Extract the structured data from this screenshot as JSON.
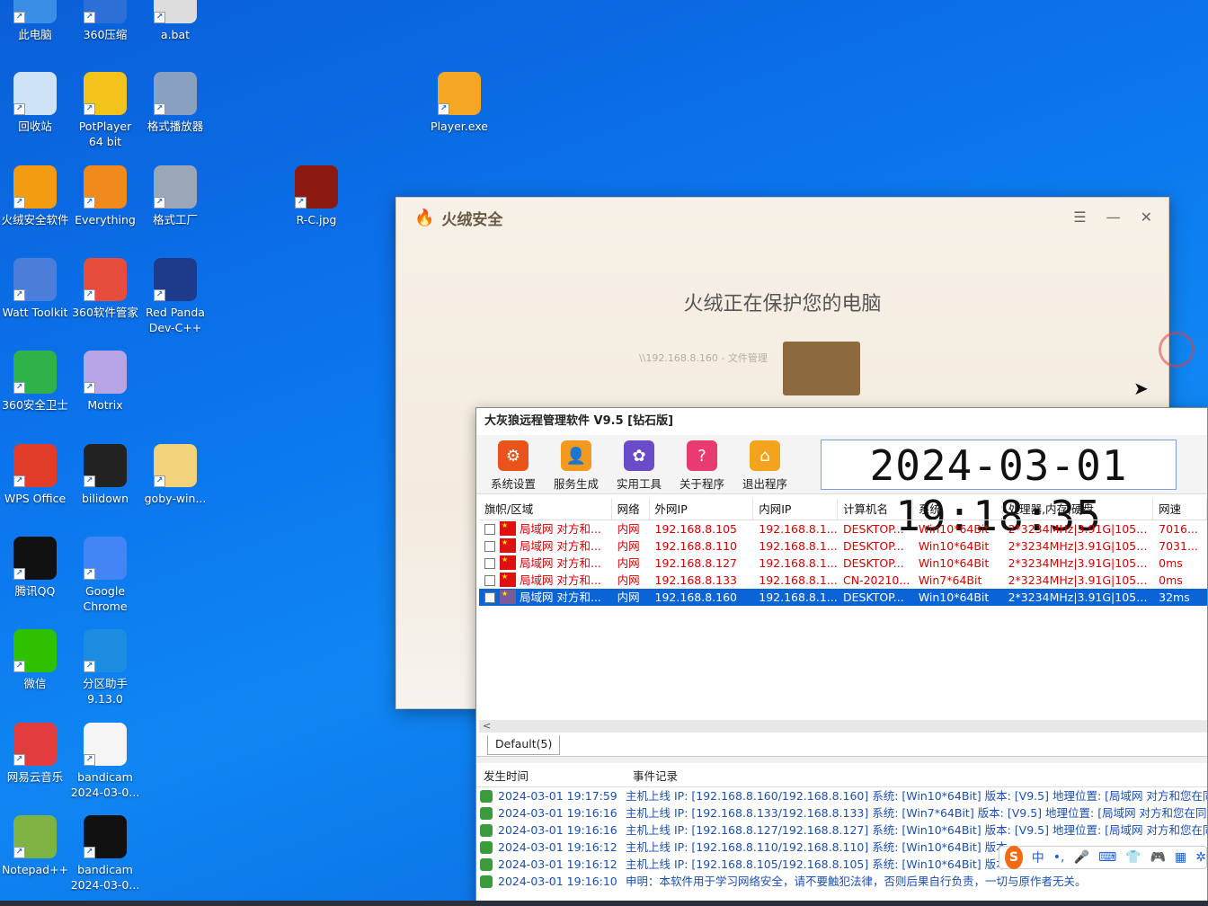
{
  "desktop": {
    "icons": [
      {
        "label": "此电脑",
        "color": "#3a8ee6"
      },
      {
        "label": "360压缩",
        "color": "#2c6fd6"
      },
      {
        "label": "a.bat",
        "color": "#dddddd"
      },
      {
        "label": "回收站",
        "color": "#cfe3f7"
      },
      {
        "label": "PotPlayer 64 bit",
        "color": "#f2c31a"
      },
      {
        "label": "格式播放器",
        "color": "#8aa0c0"
      },
      {
        "label": "Player.exe",
        "color": "#f5a623"
      },
      {
        "label": "火绒安全软件",
        "color": "#f39c12"
      },
      {
        "label": "Everything",
        "color": "#f08a1c"
      },
      {
        "label": "格式工厂",
        "color": "#9aa7b8"
      },
      {
        "label": "R-C.jpg",
        "color": "#8b1a10"
      },
      {
        "label": "Watt Toolkit",
        "color": "#4a7ed8"
      },
      {
        "label": "360软件管家",
        "color": "#e74c3c"
      },
      {
        "label": "Red Panda Dev-C++",
        "color": "#1e3a8a"
      },
      {
        "label": "360安全卫士",
        "color": "#2fb24a"
      },
      {
        "label": "Motrix",
        "color": "#b7a5e8"
      },
      {
        "label": "WPS Office",
        "color": "#e23c2a"
      },
      {
        "label": "bilidown",
        "color": "#222222"
      },
      {
        "label": "goby-win...",
        "color": "#f2d27a"
      },
      {
        "label": "腾讯QQ",
        "color": "#111111"
      },
      {
        "label": "Google Chrome",
        "color": "#4285f4"
      },
      {
        "label": "微信",
        "color": "#2dc100"
      },
      {
        "label": "分区助手 9.13.0",
        "color": "#1c8de0"
      },
      {
        "label": "网易云音乐",
        "color": "#e23c3c"
      },
      {
        "label": "bandicam 2024-03-0...",
        "color": "#f5f5f5"
      },
      {
        "label": "Notepad++",
        "color": "#7cb342"
      },
      {
        "label": "bandicam 2024-03-0...",
        "color": "#111111"
      }
    ]
  },
  "huorong": {
    "brand": "火绒安全",
    "protect_text": "火绒正在保护您的电脑",
    "ghost_path": "\\\\192.168.8.160 - 文件管理",
    "menu_icon": "☰",
    "min_icon": "—",
    "close_icon": "✕"
  },
  "rat": {
    "title": "大灰狼远程管理软件 V9.5 [钻石版]",
    "tools": [
      {
        "label": "系统设置",
        "icon": "⚙",
        "color": "#e8541a"
      },
      {
        "label": "服务生成",
        "icon": "👤",
        "color": "#f39a1e"
      },
      {
        "label": "实用工具",
        "icon": "✿",
        "color": "#6a4cc8"
      },
      {
        "label": "关于程序",
        "icon": "?",
        "color": "#e83c70"
      },
      {
        "label": "退出程序",
        "icon": "⌂",
        "color": "#f3a31e"
      }
    ],
    "clock": "2024-03-01  19:18:35",
    "columns": [
      "旗帜/区域",
      "网络",
      "外网IP",
      "内网IP",
      "计算机名",
      "系统",
      "处理器,内存,硬盘",
      "网速"
    ],
    "hosts": [
      {
        "region": "局域网 对方和...",
        "net": "内网",
        "wan": "192.168.8.105",
        "lan": "192.168.8.1...",
        "pc": "DESKTOP...",
        "os": "Win10*64Bit",
        "hw": "2*3234MHz|3.91G|1050...",
        "speed": "7016..."
      },
      {
        "region": "局域网 对方和...",
        "net": "内网",
        "wan": "192.168.8.110",
        "lan": "192.168.8.1...",
        "pc": "DESKTOP...",
        "os": "Win10*64Bit",
        "hw": "2*3234MHz|3.91G|1050...",
        "speed": "7031..."
      },
      {
        "region": "局域网 对方和...",
        "net": "内网",
        "wan": "192.168.8.127",
        "lan": "192.168.8.1...",
        "pc": "DESKTOP...",
        "os": "Win10*64Bit",
        "hw": "2*3234MHz|3.91G|1051...",
        "speed": "0ms"
      },
      {
        "region": "局域网 对方和...",
        "net": "内网",
        "wan": "192.168.8.133",
        "lan": "192.168.8.1...",
        "pc": "CN-20210...",
        "os": "Win7*64Bit",
        "hw": "2*3234MHz|3.91G|1051...",
        "speed": "0ms"
      },
      {
        "region": "局域网 对方和...",
        "net": "内网",
        "wan": "192.168.8.160",
        "lan": "192.168.8.1...",
        "pc": "DESKTOP...",
        "os": "Win10*64Bit",
        "hw": "2*3234MHz|3.91G|1050...",
        "speed": "32ms"
      }
    ],
    "scroll_arrow": "<",
    "group_tab": "Default(5)",
    "log_columns": [
      "发生时间",
      "事件记录"
    ],
    "logs": [
      {
        "time": "2024-03-01 19:17:59",
        "event": "主机上线 IP: [192.168.8.160/192.168.8.160]    系统: [Win10*64Bit]    版本: [V9.5]    地理位置: [局域网 对方和您在同"
      },
      {
        "time": "2024-03-01 19:16:16",
        "event": "主机上线 IP: [192.168.8.133/192.168.8.133]    系统: [Win7*64Bit]    版本: [V9.5]    地理位置: [局域网 对方和您在同"
      },
      {
        "time": "2024-03-01 19:16:16",
        "event": "主机上线 IP: [192.168.8.127/192.168.8.127]    系统: [Win10*64Bit]    版本: [V9.5]    地理位置: [局域网 对方和您在同"
      },
      {
        "time": "2024-03-01 19:16:12",
        "event": "主机上线 IP: [192.168.8.110/192.168.8.110]    系统: [Win10*64Bit]    版本"
      },
      {
        "time": "2024-03-01 19:16:12",
        "event": "主机上线 IP: [192.168.8.105/192.168.8.105]    系统: [Win10*64Bit]    版本"
      },
      {
        "time": "2024-03-01 19:16:10",
        "event": "申明：本软件用于学习网络安全，请不要触犯法律，否则后果自行负责，一切与原作者无关。"
      }
    ]
  },
  "ime": {
    "logo": "S",
    "lang": "中",
    "punct": "•,",
    "mic": "🎤",
    "keyboard": "⌨",
    "skin": "👕",
    "game": "🎮",
    "apps": "▦",
    "settings": "✲"
  }
}
